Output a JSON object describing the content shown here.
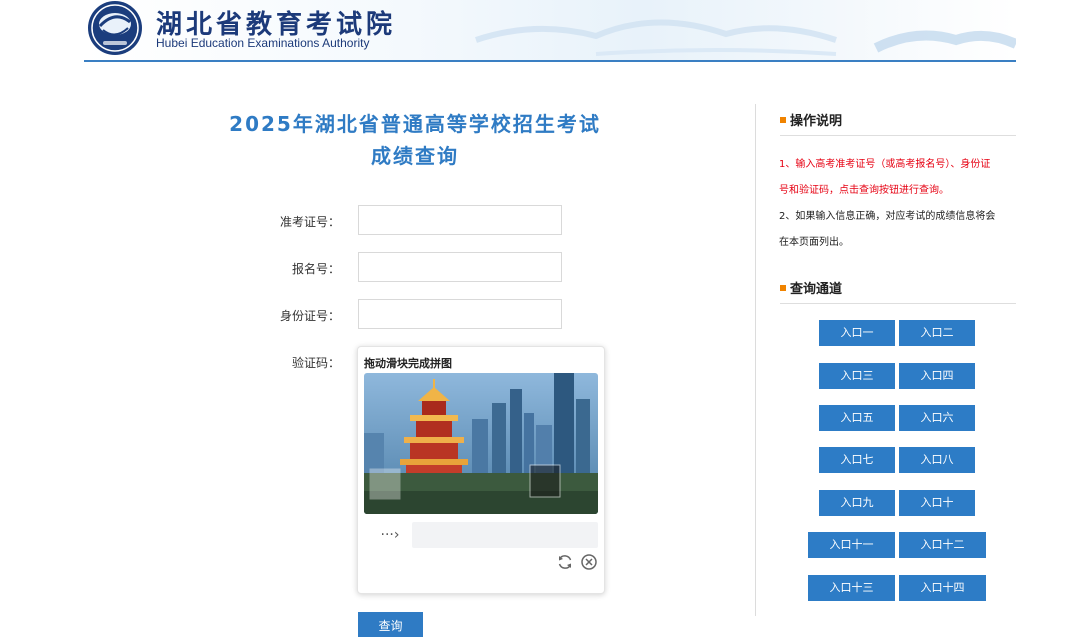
{
  "header": {
    "site_name_cn": "湖北省教育考试院",
    "site_name_en": "Hubei Education Examinations Authority"
  },
  "title": {
    "line1": "2025年湖北省普通高等学校招生考试",
    "line2": "成绩查询"
  },
  "form": {
    "exam_no_label": "准考证号：",
    "exam_no_value": "",
    "reg_no_label": "报名号：",
    "reg_no_value": "",
    "id_no_label": "身份证号：",
    "id_no_value": "",
    "captcha_label": "验证码：",
    "submit_label": "查询"
  },
  "captcha": {
    "title": "拖动滑块完成拼图",
    "handle_glyph": "···›"
  },
  "instructions": {
    "heading": "操作说明",
    "line1": "1、输入高考准考证号（或高考报名号）、身份证",
    "line2": "号和验证码，点击查询按钮进行查询。",
    "line3": "2、如果输入信息正确，对应考试的成绩信息将会",
    "line4": "在本页面列出。"
  },
  "channels": {
    "heading": "查询通道",
    "entries": [
      "入口一",
      "入口二",
      "入口三",
      "入口四",
      "入口五",
      "入口六",
      "入口七",
      "入口八",
      "入口九",
      "入口十",
      "入口十一",
      "入口十二",
      "入口十三",
      "入口十四"
    ]
  },
  "colors": {
    "accent": "#2f7bc4",
    "button": "#2d7cc6",
    "bullet": "#f08300",
    "warning_text": "#e60012"
  }
}
